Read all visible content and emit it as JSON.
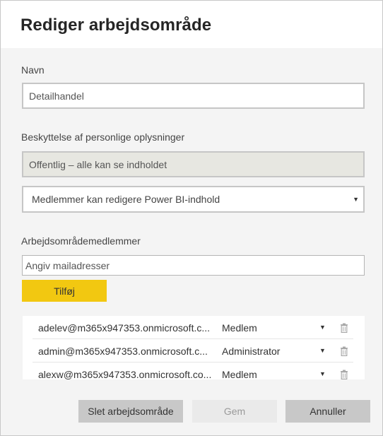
{
  "dialog": {
    "title": "Rediger arbejdsområde"
  },
  "name": {
    "label": "Navn",
    "value": "Detailhandel"
  },
  "privacy": {
    "label": "Beskyttelse af personlige oplysninger",
    "value": "Offentlig – alle kan se indholdet",
    "permission_selected": "Medlemmer kan redigere Power BI-indhold"
  },
  "members": {
    "label": "Arbejdsområdemedlemmer",
    "email_placeholder": "Angiv mailadresser",
    "add_label": "Tilføj",
    "rows": [
      {
        "email": "adelev@m365x947353.onmicrosoft.c...",
        "role": "Medlem"
      },
      {
        "email": "admin@m365x947353.onmicrosoft.c...",
        "role": "Administrator"
      },
      {
        "email": "alexw@m365x947353.onmicrosoft.co...",
        "role": "Medlem"
      }
    ]
  },
  "footer": {
    "delete_label": "Slet arbejdsområde",
    "save_label": "Gem",
    "cancel_label": "Annuller"
  },
  "icons": {
    "dropdown": "caret-down-icon",
    "remove": "trash-icon"
  },
  "colors": {
    "accent_yellow": "#f2c811",
    "disabled_button": "#eaeaea",
    "secondary_button": "#c8c8c8"
  }
}
